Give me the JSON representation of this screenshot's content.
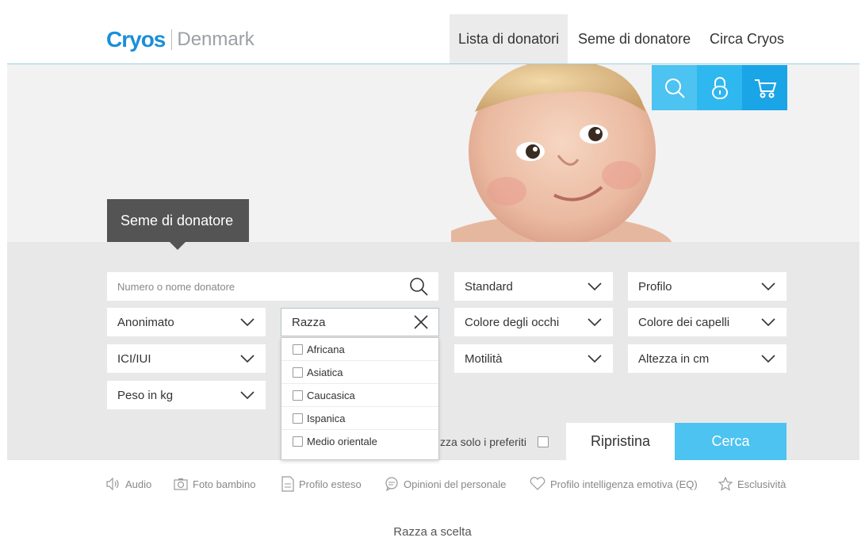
{
  "header": {
    "logo_brand": "Cryos",
    "logo_country": "Denmark",
    "nav": [
      {
        "label": "Lista di donatori",
        "active": true
      },
      {
        "label": "Seme di donatore",
        "active": false
      },
      {
        "label": "Circa Cryos",
        "active": false
      }
    ]
  },
  "hero": {
    "icons": [
      "search-icon",
      "lock-icon",
      "cart-icon"
    ],
    "tab_label": "Seme di donatore"
  },
  "filters": {
    "search_placeholder": "Numero o nome donatore",
    "standard": "Standard",
    "profilo": "Profilo",
    "anonimato": "Anonimato",
    "razza": "Razza",
    "colore_occhi": "Colore degli occhi",
    "colore_capelli": "Colore dei capelli",
    "ici_iui": "ICI/IUI",
    "motilita": "Motilità",
    "altezza": "Altezza in cm",
    "peso": "Peso in kg"
  },
  "razza_options": [
    "Africana",
    "Asiatica",
    "Caucasica",
    "Ispanica",
    "Medio orientale"
  ],
  "favorites_label": "zza solo i preferiti",
  "buttons": {
    "reset": "Ripristina",
    "search": "Cerca"
  },
  "legend": {
    "audio": "Audio",
    "foto": "Foto bambino",
    "profilo": "Profilo esteso",
    "opinioni": "Opinioni del personale",
    "eq": "Profilo intelligenza emotiva (EQ)",
    "esclusivita": "Esclusività"
  },
  "caption": "Razza a scelta",
  "colors": {
    "accent": "#4cc3f1",
    "dark_tab": "#545454",
    "panel": "#e8e8e8"
  }
}
